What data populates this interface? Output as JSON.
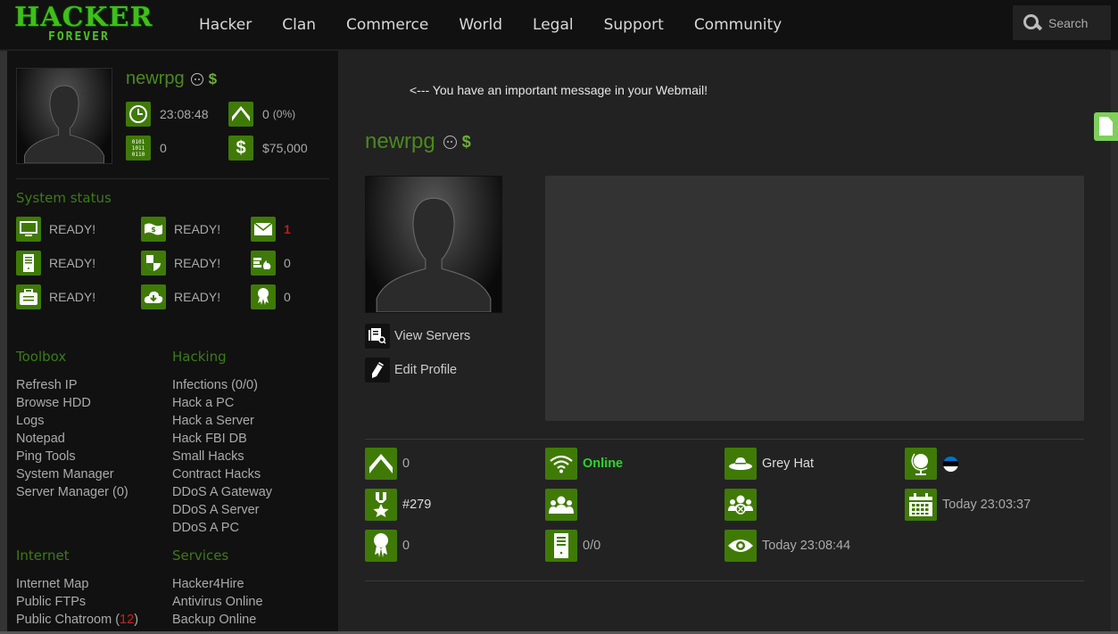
{
  "header": {
    "logo_main": "HACKER",
    "logo_sub": "FOREVER",
    "nav": [
      "Hacker",
      "Clan",
      "Commerce",
      "World",
      "Legal",
      "Support",
      "Community"
    ],
    "search": {
      "placeholder": "Search",
      "icon": "search-icon"
    }
  },
  "sidebar": {
    "username": "newrpg",
    "badges": {
      "face": "face-icon",
      "premium": "$"
    },
    "stats": {
      "time": "23:08:48",
      "rank_value": "0",
      "rank_pct": "(0%)",
      "bits": "0",
      "money": "$75,000"
    },
    "system_status": {
      "title": "System status",
      "rows": [
        {
          "icon": "monitor-icon",
          "value": "READY!"
        },
        {
          "icon": "money-icon",
          "value": "READY!"
        },
        {
          "icon": "mail-icon",
          "value": "1"
        },
        {
          "icon": "server-icon",
          "value": "READY!"
        },
        {
          "icon": "shield-icon",
          "value": "READY!"
        },
        {
          "icon": "firewall-icon",
          "value": "0"
        },
        {
          "icon": "briefcase-icon",
          "value": "READY!"
        },
        {
          "icon": "cloud-download-icon",
          "value": "READY!"
        },
        {
          "icon": "award-icon",
          "value": "0"
        }
      ]
    },
    "toolbox": {
      "title": "Toolbox",
      "items": [
        "Refresh IP",
        "Browse HDD",
        "Logs",
        "Notepad",
        "Ping Tools",
        "System Manager",
        "Server Manager (0)"
      ]
    },
    "hacking": {
      "title": "Hacking",
      "items": [
        "Infections (0/0)",
        "Hack a PC",
        "Hack a Server",
        "Hack FBI DB",
        "Small Hacks",
        "Contract Hacks",
        "DDoS A Gateway",
        "DDoS A Server",
        "DDoS A PC"
      ]
    },
    "internet": {
      "title": "Internet",
      "items": [
        "Internet Map",
        "Public FTPs"
      ],
      "chatroom_label": "Public Chatroom (",
      "chatroom_count": "12",
      "chatroom_close": ")"
    },
    "services": {
      "title": "Services",
      "items": [
        "Hacker4Hire",
        "Antivirus Online",
        "Backup Online"
      ]
    }
  },
  "main": {
    "webmail_message": "<--- You have an important message in your Webmail!",
    "username": "newrpg",
    "premium": "$",
    "actions": [
      "View Servers",
      "Edit Profile"
    ],
    "profile": {
      "rank": "0",
      "status": "Online",
      "hat": "Grey Hat",
      "country_flag": [
        "#0072ce",
        "#000000",
        "#ffffff"
      ],
      "ranking": "#279",
      "clan": "",
      "clan_enemy": "",
      "registered": "Today 23:03:37",
      "awards": "0",
      "servers": "0/0",
      "last_seen": "Today 23:08:44"
    }
  },
  "colors": {
    "accent_green": "#3f7a06",
    "name_green": "#4a8a1c",
    "online_green": "#2ad52a",
    "alert_red": "#c21a1a",
    "doc_tab_green": "#7ed05a"
  }
}
